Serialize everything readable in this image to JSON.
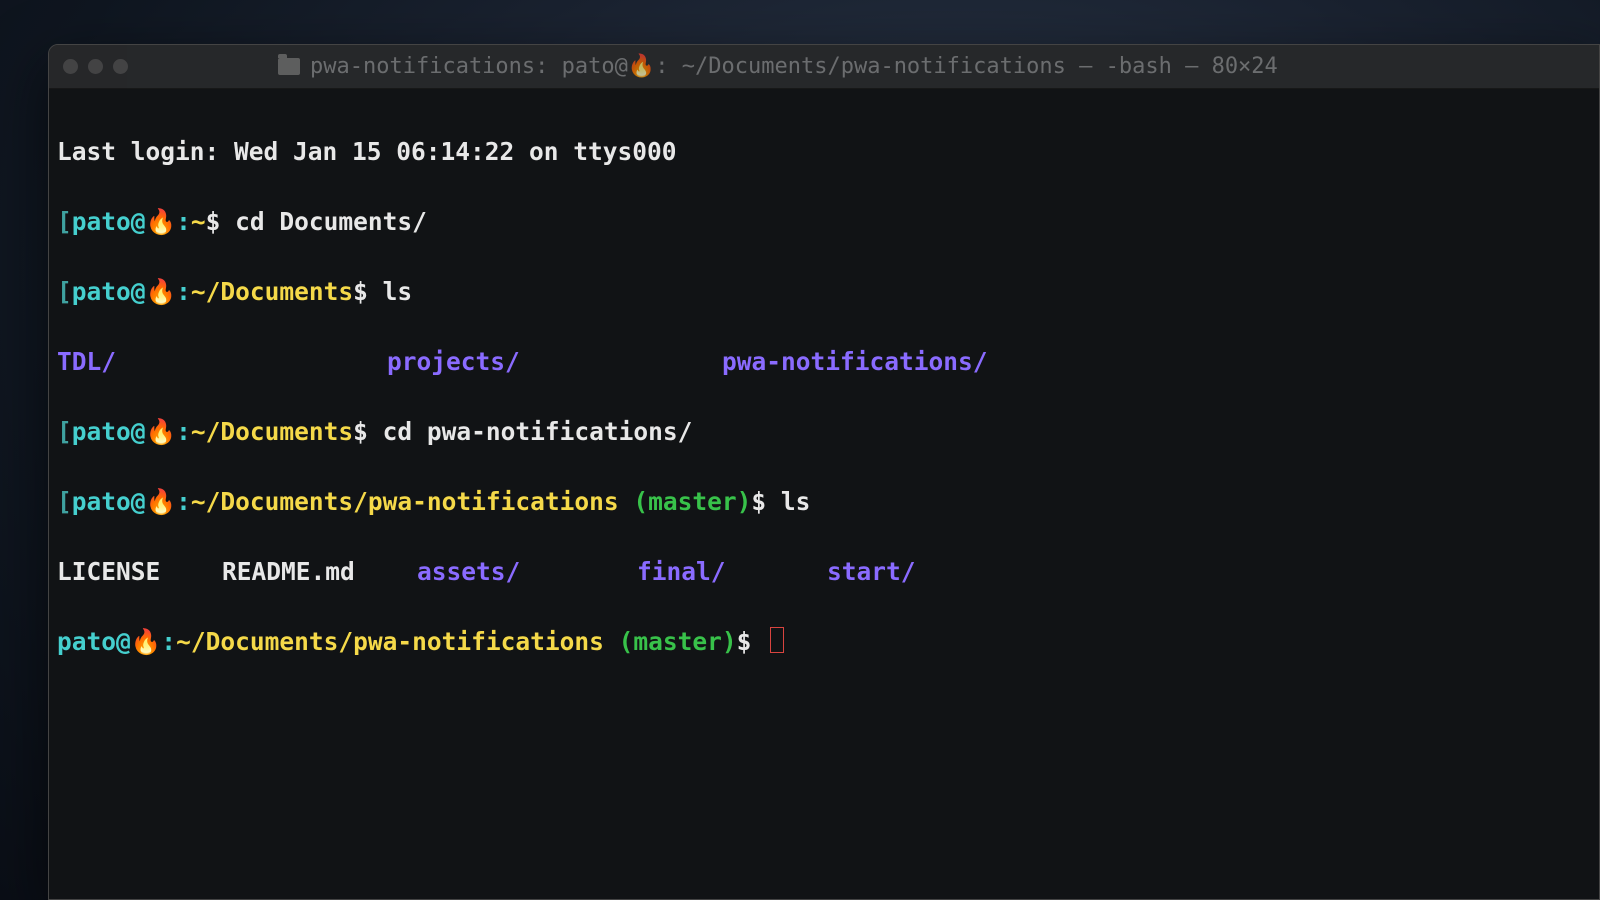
{
  "window": {
    "title": "pwa-notifications: pato@🔥: ~/Documents/pwa-notifications — -bash — 80×24"
  },
  "session": {
    "last_login": "Last login: Wed Jan 15 06:14:22 on ttys000",
    "user": "pato",
    "host_emoji": "🔥"
  },
  "lines": {
    "l1": {
      "bracket": "[",
      "user": "pato",
      "at": "@",
      "host": "🔥",
      "colon": ":",
      "path": "~",
      "dollar": "$ ",
      "cmd": "cd Documents/"
    },
    "l2": {
      "bracket": "[",
      "user": "pato",
      "at": "@",
      "host": "🔥",
      "colon": ":",
      "path": "~/Documents",
      "dollar": "$ ",
      "cmd": "ls"
    },
    "l3_items": {
      "a": "TDL/",
      "b": "projects/",
      "c": "pwa-notifications/"
    },
    "l4": {
      "bracket": "[",
      "user": "pato",
      "at": "@",
      "host": "🔥",
      "colon": ":",
      "path": "~/Documents",
      "dollar": "$ ",
      "cmd": "cd pwa-notifications/"
    },
    "l5": {
      "bracket": "[",
      "user": "pato",
      "at": "@",
      "host": "🔥",
      "colon": ":",
      "path": "~/Documents/pwa-notifications",
      "space": " ",
      "branch": "(master)",
      "dollar": "$ ",
      "cmd": "ls"
    },
    "l6_items": {
      "a": "LICENSE",
      "b": "README.md",
      "c": "assets/",
      "d": "final/",
      "e": "start/"
    },
    "l7": {
      "user": "pato",
      "at": "@",
      "host": "🔥",
      "colon": ":",
      "path": "~/Documents/pwa-notifications",
      "space": " ",
      "branch": "(master)",
      "dollar": "$ "
    }
  }
}
